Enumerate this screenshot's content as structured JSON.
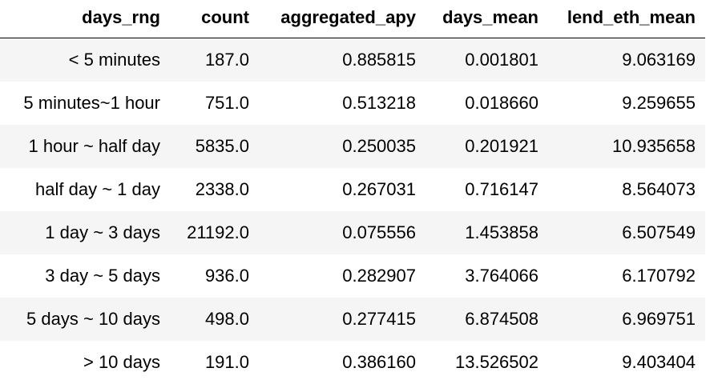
{
  "table": {
    "columns": [
      "days_rng",
      "count",
      "aggregated_apy",
      "days_mean",
      "lend_eth_mean"
    ],
    "rows": [
      [
        "< 5 minutes",
        "187.0",
        "0.885815",
        "0.001801",
        "9.063169"
      ],
      [
        "5 minutes~1 hour",
        "751.0",
        "0.513218",
        "0.018660",
        "9.259655"
      ],
      [
        "1 hour ~ half day",
        "5835.0",
        "0.250035",
        "0.201921",
        "10.935658"
      ],
      [
        "half day ~ 1 day",
        "2338.0",
        "0.267031",
        "0.716147",
        "8.564073"
      ],
      [
        "1 day ~ 3 days",
        "21192.0",
        "0.075556",
        "1.453858",
        "6.507549"
      ],
      [
        "3 day ~ 5 days",
        "936.0",
        "0.282907",
        "3.764066",
        "6.170792"
      ],
      [
        "5 days ~ 10 days",
        "498.0",
        "0.277415",
        "6.874508",
        "6.969751"
      ],
      [
        "> 10 days",
        "191.0",
        "0.386160",
        "13.526502",
        "9.403404"
      ]
    ]
  },
  "colors": {
    "stripe": "#f5f5f5",
    "background": "#ffffff",
    "text": "#000000",
    "header_rule": "#000000"
  }
}
